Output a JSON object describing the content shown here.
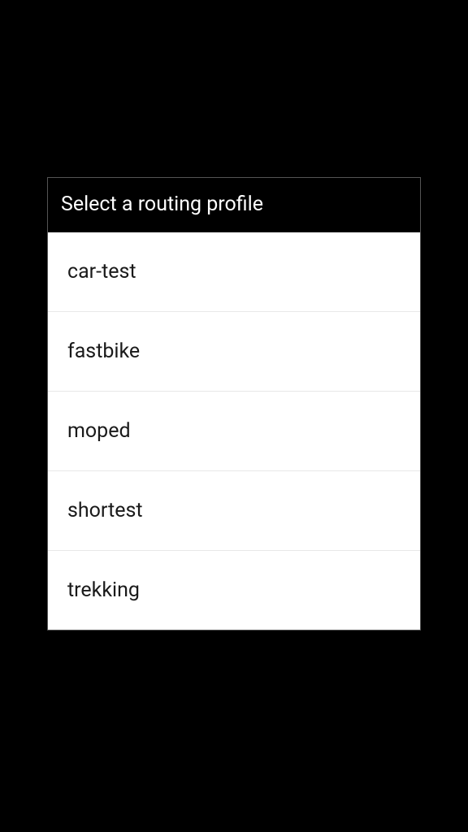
{
  "dialog": {
    "title": "Select a routing profile",
    "items": [
      {
        "label": "car-test"
      },
      {
        "label": "fastbike"
      },
      {
        "label": "moped"
      },
      {
        "label": "shortest"
      },
      {
        "label": "trekking"
      }
    ]
  }
}
